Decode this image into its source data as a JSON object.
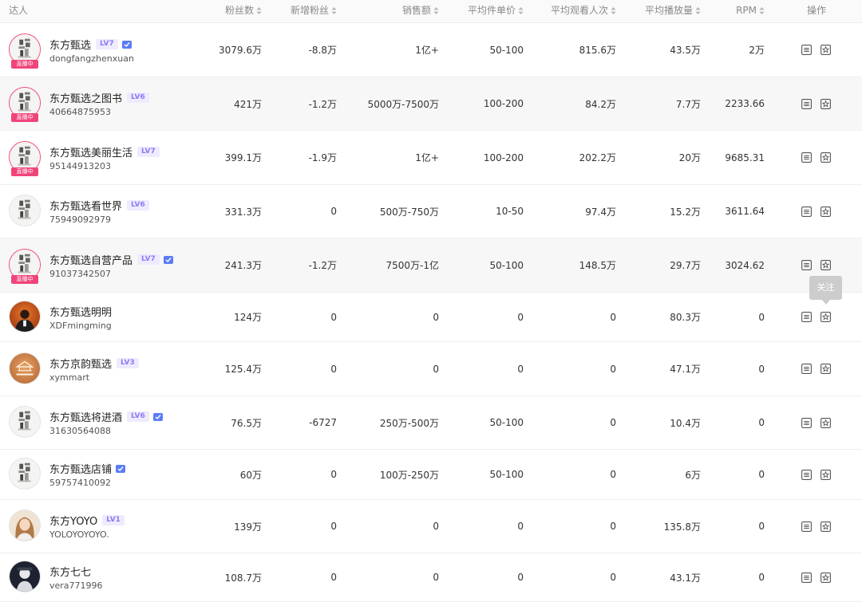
{
  "header": {
    "columns": [
      {
        "key": "influencer",
        "label": "达人",
        "sortable": false
      },
      {
        "key": "fans",
        "label": "粉丝数",
        "sortable": true
      },
      {
        "key": "new_fans",
        "label": "新增粉丝",
        "sortable": true
      },
      {
        "key": "sales",
        "label": "销售额",
        "sortable": true
      },
      {
        "key": "avg_price",
        "label": "平均件单价",
        "sortable": true
      },
      {
        "key": "avg_viewers",
        "label": "平均观看人次",
        "sortable": true
      },
      {
        "key": "avg_plays",
        "label": "平均播放量",
        "sortable": true
      },
      {
        "key": "rpm",
        "label": "RPM",
        "sortable": true
      },
      {
        "key": "actions",
        "label": "操作",
        "sortable": false
      }
    ]
  },
  "rows": [
    {
      "name": "东方甄选",
      "level": "LV7",
      "verified": true,
      "handle": "dongfangzhenxuan",
      "avatar": "book-cover-avatar",
      "live": true,
      "live_label": "直播中",
      "fans": "3079.6万",
      "new_fans": "-8.8万",
      "sales": "1亿+",
      "avg_price": "50-100",
      "avg_viewers": "815.6万",
      "avg_plays": "43.5万",
      "rpm": "2万"
    },
    {
      "name": "东方甄选之图书",
      "level": "LV6",
      "verified": false,
      "handle": "40664875953",
      "avatar": "book-cover-avatar",
      "live": true,
      "live_label": "直播中",
      "fans": "421万",
      "new_fans": "-1.2万",
      "sales": "5000万-7500万",
      "avg_price": "100-200",
      "avg_viewers": "84.2万",
      "avg_plays": "7.7万",
      "rpm": "2233.66"
    },
    {
      "name": "东方甄选美丽生活",
      "level": "LV7",
      "verified": false,
      "handle": "95144913203",
      "avatar": "book-cover-avatar",
      "live": true,
      "live_label": "直播中",
      "fans": "399.1万",
      "new_fans": "-1.9万",
      "sales": "1亿+",
      "avg_price": "100-200",
      "avg_viewers": "202.2万",
      "avg_plays": "20万",
      "rpm": "9685.31"
    },
    {
      "name": "东方甄选看世界",
      "level": "LV6",
      "verified": false,
      "handle": "75949092979",
      "avatar": "book-cover-avatar",
      "live": false,
      "live_label": "",
      "fans": "331.3万",
      "new_fans": "0",
      "sales": "500万-750万",
      "avg_price": "10-50",
      "avg_viewers": "97.4万",
      "avg_plays": "15.2万",
      "rpm": "3611.64"
    },
    {
      "name": "东方甄选自营产品",
      "level": "LV7",
      "verified": true,
      "handle": "91037342507",
      "avatar": "book-cover-avatar",
      "live": true,
      "live_label": "直播中",
      "fans": "241.3万",
      "new_fans": "-1.2万",
      "sales": "7500万-1亿",
      "avg_price": "50-100",
      "avg_viewers": "148.5万",
      "avg_plays": "29.7万",
      "rpm": "3024.62"
    },
    {
      "name": "东方甄选明明",
      "level": "",
      "verified": false,
      "handle": "XDFmingming",
      "avatar": "portrait-orange-avatar",
      "live": false,
      "live_label": "",
      "fans": "124万",
      "new_fans": "0",
      "sales": "0",
      "avg_price": "0",
      "avg_viewers": "0",
      "avg_plays": "80.3万",
      "rpm": "0"
    },
    {
      "name": "东方京韵甄选",
      "level": "LV3",
      "verified": false,
      "handle": "xymmart",
      "avatar": "logo-brown-avatar",
      "live": false,
      "live_label": "",
      "fans": "125.4万",
      "new_fans": "0",
      "sales": "0",
      "avg_price": "0",
      "avg_viewers": "0",
      "avg_plays": "47.1万",
      "rpm": "0"
    },
    {
      "name": "东方甄选将进酒",
      "level": "LV6",
      "verified": true,
      "handle": "31630564088",
      "avatar": "book-cover-avatar",
      "live": false,
      "live_label": "",
      "fans": "76.5万",
      "new_fans": "-6727",
      "sales": "250万-500万",
      "avg_price": "50-100",
      "avg_viewers": "0",
      "avg_plays": "10.4万",
      "rpm": "0"
    },
    {
      "name": "东方甄选店铺",
      "level": "",
      "verified": true,
      "handle": "59757410092",
      "avatar": "book-cover-avatar",
      "live": false,
      "live_label": "",
      "fans": "60万",
      "new_fans": "0",
      "sales": "100万-250万",
      "avg_price": "50-100",
      "avg_viewers": "0",
      "avg_plays": "6万",
      "rpm": "0"
    },
    {
      "name": "东方YOYO",
      "level": "LV1",
      "verified": false,
      "handle": "YOLOYOYOYO.",
      "avatar": "portrait-woman-avatar",
      "live": false,
      "live_label": "",
      "fans": "139万",
      "new_fans": "0",
      "sales": "0",
      "avg_price": "0",
      "avg_viewers": "0",
      "avg_plays": "135.8万",
      "rpm": "0"
    },
    {
      "name": "东方七七",
      "level": "",
      "verified": false,
      "handle": "vera771996",
      "avatar": "portrait-dark-avatar",
      "live": false,
      "live_label": "",
      "fans": "108.7万",
      "new_fans": "0",
      "sales": "0",
      "avg_price": "0",
      "avg_viewers": "0",
      "avg_plays": "43.1万",
      "rpm": "0"
    }
  ],
  "actions": {
    "detail_icon": "list-detail-icon",
    "follow_icon": "star-badge-icon"
  },
  "tooltip": {
    "text": "关注"
  },
  "colors": {
    "live_badge": "#f0457a",
    "level_badge_text": "#8a7cf3",
    "verified_badge": "#5a7cf6",
    "header_bg": "#fafafa",
    "alt_row_bg": "#f7f7f8"
  }
}
